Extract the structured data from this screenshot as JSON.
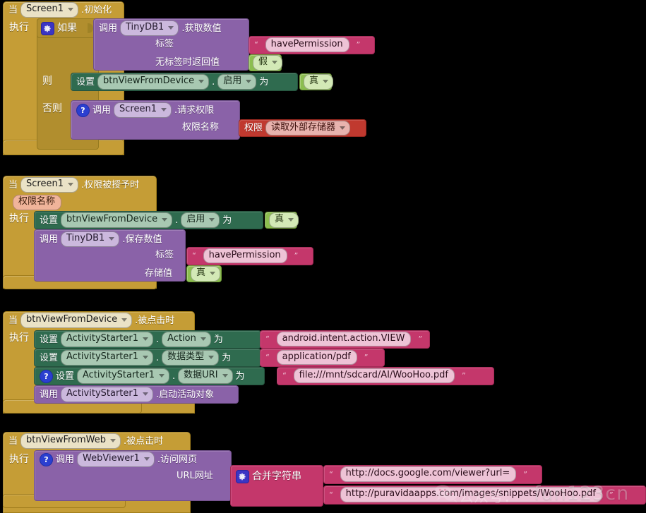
{
  "app": {
    "title": "MIT App Inventor Blocks Editor",
    "background_color": "#000000"
  },
  "icons": {
    "mutator_gear": "gear-icon",
    "help": "?",
    "dropdown_caret": "chevron-down-icon"
  },
  "colors": {
    "event_block": "#c59d36",
    "control_block": "#b18e2e",
    "call_block": "#8a62a8",
    "setter_block": "#2f6b4f",
    "text_block": "#c4376b",
    "logic_block": "#8cbe4f",
    "helper_block": "#c0392f"
  },
  "blocks": [
    {
      "id": "screen1-initialize",
      "when_label": "当",
      "component": "Screen1",
      "event": ".初始化",
      "do_label": "执行",
      "control": {
        "if_label": "如果",
        "then_label": "则",
        "else_label": "否则",
        "condition": {
          "call_label": "调用",
          "component": "TinyDB1",
          "method": ".获取数值",
          "args": [
            {
              "label": "标签",
              "type": "text",
              "value": "havePermission"
            },
            {
              "label": "无标签时返回值",
              "type": "logic",
              "value": "假"
            }
          ]
        },
        "then_statement": {
          "set_label": "设置",
          "component": "btnViewFromDevice",
          "dot": ".",
          "property": "启用",
          "to_label": "为",
          "value": {
            "type": "logic",
            "value": "真"
          }
        },
        "else_statement": {
          "help": "?",
          "call_label": "调用",
          "component": "Screen1",
          "method": ".请求权限",
          "args": [
            {
              "label": "权限名称",
              "type": "helper",
              "prefix": "权限",
              "value": "读取外部存储器"
            }
          ]
        }
      }
    },
    {
      "id": "screen1-permission-granted",
      "when_label": "当",
      "component": "Screen1",
      "event": ".权限被授予时",
      "parameters": [
        "权限名称"
      ],
      "do_label": "执行",
      "statements": [
        {
          "kind": "set",
          "set_label": "设置",
          "component": "btnViewFromDevice",
          "dot": ".",
          "property": "启用",
          "to_label": "为",
          "value": {
            "type": "logic",
            "value": "真"
          }
        },
        {
          "kind": "call",
          "call_label": "调用",
          "component": "TinyDB1",
          "method": ".保存数值",
          "args": [
            {
              "label": "标签",
              "type": "text",
              "value": "havePermission"
            },
            {
              "label": "存储值",
              "type": "logic",
              "value": "真"
            }
          ]
        }
      ]
    },
    {
      "id": "btnviewfromdevice-click",
      "when_label": "当",
      "component": "btnViewFromDevice",
      "event": ".被点击时",
      "do_label": "执行",
      "statements": [
        {
          "kind": "set",
          "set_label": "设置",
          "component": "ActivityStarter1",
          "dot": ".",
          "property": "Action",
          "to_label": "为",
          "value": {
            "type": "text",
            "value": "android.intent.action.VIEW"
          }
        },
        {
          "kind": "set",
          "set_label": "设置",
          "component": "ActivityStarter1",
          "dot": ".",
          "property": "数据类型",
          "to_label": "为",
          "value": {
            "type": "text",
            "value": "application/pdf"
          }
        },
        {
          "kind": "set",
          "help": "?",
          "set_label": "设置",
          "component": "ActivityStarter1",
          "dot": ".",
          "property": "数据URI",
          "to_label": "为",
          "value": {
            "type": "text",
            "value": "file:///mnt/sdcard/AI/WooHoo.pdf"
          }
        },
        {
          "kind": "call",
          "call_label": "调用",
          "component": "ActivityStarter1",
          "method": ".启动活动对象"
        }
      ]
    },
    {
      "id": "btnviewfromweb-click",
      "when_label": "当",
      "component": "btnViewFromWeb",
      "event": ".被点击时",
      "do_label": "执行",
      "statements": [
        {
          "kind": "call",
          "help": "?",
          "call_label": "调用",
          "component": "WebViewer1",
          "method": ".访问网页",
          "args": [
            {
              "label": "URL网址",
              "type": "join",
              "join_label": "合并字符串",
              "items": [
                "http://docs.google.com/viewer?url=",
                "http://puravidaapps.com/images/snippets/WooHoo.pdf"
              ]
            }
          ]
        }
      ]
    }
  ],
  "watermark": {
    "logo": "wechat-icon",
    "prefix": "公众号：",
    "handle": "fun123cn"
  }
}
